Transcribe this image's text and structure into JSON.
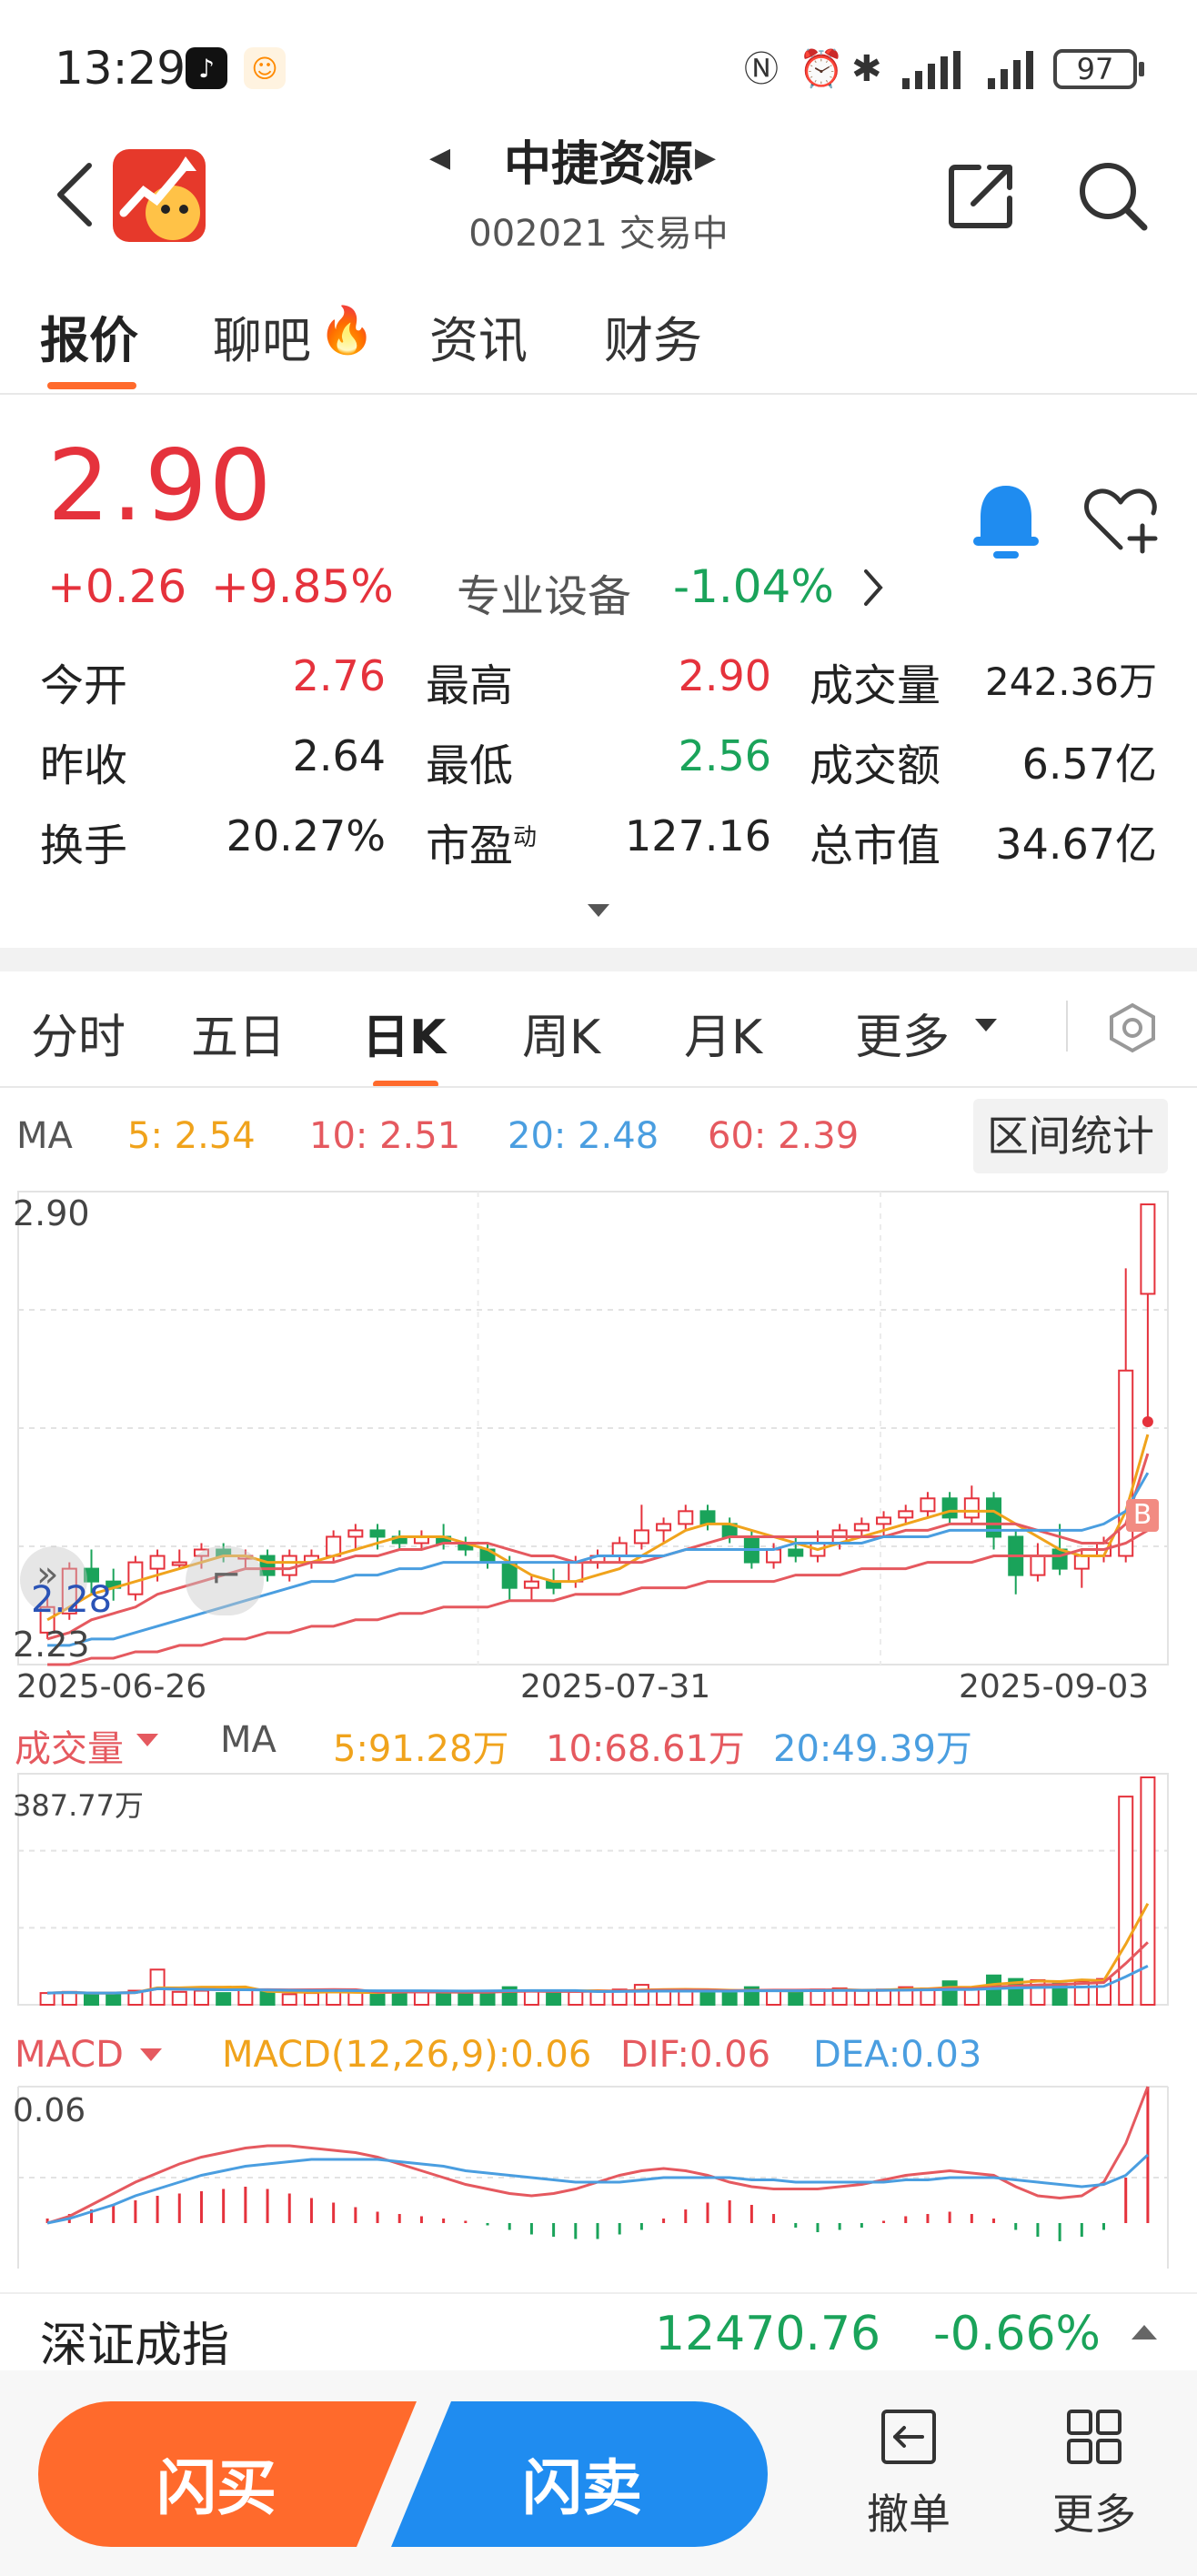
{
  "status_bar": {
    "time": "13:29",
    "battery": "97",
    "icons": [
      "tiktok-icon",
      "app-notify-icon",
      "nfc-icon",
      "alarm-icon",
      "bluetooth-icon",
      "signal-1-icon",
      "signal-2-icon",
      "battery-icon"
    ]
  },
  "header": {
    "title": "中捷资源",
    "subtitle": "002021 交易中",
    "icons": [
      "back-icon",
      "app-logo",
      "prev-stock-icon",
      "next-stock-icon",
      "share-icon",
      "search-icon"
    ]
  },
  "tabs": [
    "报价",
    "聊吧",
    "资讯",
    "财务"
  ],
  "active_tab": "报价",
  "quote": {
    "price": "2.90",
    "change": "+0.26",
    "change_pct": "+9.85%",
    "sector": "专业设备",
    "sector_change": "-1.04%",
    "rows": [
      [
        {
          "label": "今开",
          "value": "2.76",
          "tone": "red"
        },
        {
          "label": "最高",
          "value": "2.90",
          "tone": "red"
        },
        {
          "label": "成交量",
          "value": "242.36万",
          "tone": "dark"
        }
      ],
      [
        {
          "label": "昨收",
          "value": "2.64",
          "tone": "dark"
        },
        {
          "label": "最低",
          "value": "2.56",
          "tone": "green"
        },
        {
          "label": "成交额",
          "value": "6.57亿",
          "tone": "dark"
        }
      ],
      [
        {
          "label": "换手",
          "value": "20.27%",
          "tone": "dark"
        },
        {
          "label": "市盈",
          "label_sup": "动",
          "value": "127.16",
          "tone": "dark"
        },
        {
          "label": "总市值",
          "value": "34.67亿",
          "tone": "dark"
        }
      ]
    ],
    "colors": {
      "up": "#e5323c",
      "down": "#1aa35a",
      "accent": "#ff6a2c",
      "bell": "#1f8cf0"
    }
  },
  "chart_tabs": [
    "分时",
    "五日",
    "日K",
    "周K",
    "月K",
    "更多"
  ],
  "active_chart_tab": "日K",
  "ma_legend": {
    "label": "MA",
    "items": [
      {
        "text": "5:  2.54",
        "color": "#f0a31c"
      },
      {
        "text": "10:  2.51",
        "color": "#e5595f"
      },
      {
        "text": "20:  2.48",
        "color": "#4a9ee0"
      },
      {
        "text": "60:  2.39",
        "color": "#e5595f"
      }
    ],
    "range_button": "区间统计"
  },
  "kline_labels": {
    "max": "2.90",
    "current_marker": "2.28",
    "min": "2.23",
    "dates": [
      "2025-06-26",
      "2025-07-31",
      "2025-09-03"
    ],
    "buy_marker": "B"
  },
  "volume_legend": {
    "label": "成交量",
    "ma_label": "MA",
    "ma5": "5:91.28万",
    "ma10": "10:68.61万",
    "ma20": "20:49.39万",
    "max_label": "387.77万"
  },
  "macd_legend": {
    "label": "MACD",
    "params": "MACD(12,26,9):0.06",
    "dif": "DIF:0.06",
    "dea": "DEA:0.03",
    "max_label": "0.06"
  },
  "index_bar": {
    "name": "深证成指",
    "value": "12470.76",
    "change": "-0.66%"
  },
  "actions": {
    "buy": "闪买",
    "sell": "闪卖",
    "cancel": "撤单",
    "more": "更多"
  },
  "chart_data": [
    {
      "type": "candlestick",
      "title": "",
      "x_labels": [
        "2025-06-26",
        "2025-07-31",
        "2025-09-03"
      ],
      "ylim": [
        2.23,
        2.9
      ],
      "candles": [
        {
          "o": 2.23,
          "h": 2.29,
          "l": 2.22,
          "c": 2.27
        },
        {
          "o": 2.26,
          "h": 2.34,
          "l": 2.25,
          "c": 2.33
        },
        {
          "o": 2.33,
          "h": 2.36,
          "l": 2.29,
          "c": 2.31
        },
        {
          "o": 2.31,
          "h": 2.33,
          "l": 2.28,
          "c": 2.3
        },
        {
          "o": 2.29,
          "h": 2.35,
          "l": 2.28,
          "c": 2.34
        },
        {
          "o": 2.33,
          "h": 2.36,
          "l": 2.31,
          "c": 2.35
        },
        {
          "o": 2.34,
          "h": 2.36,
          "l": 2.33,
          "c": 2.34
        },
        {
          "o": 2.35,
          "h": 2.37,
          "l": 2.33,
          "c": 2.36
        },
        {
          "o": 2.36,
          "h": 2.37,
          "l": 2.34,
          "c": 2.35
        },
        {
          "o": 2.35,
          "h": 2.36,
          "l": 2.33,
          "c": 2.35
        },
        {
          "o": 2.35,
          "h": 2.36,
          "l": 2.31,
          "c": 2.32
        },
        {
          "o": 2.32,
          "h": 2.36,
          "l": 2.31,
          "c": 2.35
        },
        {
          "o": 2.34,
          "h": 2.36,
          "l": 2.33,
          "c": 2.35
        },
        {
          "o": 2.35,
          "h": 2.39,
          "l": 2.34,
          "c": 2.38
        },
        {
          "o": 2.38,
          "h": 2.4,
          "l": 2.36,
          "c": 2.39
        },
        {
          "o": 2.39,
          "h": 2.4,
          "l": 2.36,
          "c": 2.38
        },
        {
          "o": 2.38,
          "h": 2.39,
          "l": 2.36,
          "c": 2.37
        },
        {
          "o": 2.37,
          "h": 2.39,
          "l": 2.36,
          "c": 2.38
        },
        {
          "o": 2.38,
          "h": 2.4,
          "l": 2.36,
          "c": 2.37
        },
        {
          "o": 2.37,
          "h": 2.38,
          "l": 2.35,
          "c": 2.36
        },
        {
          "o": 2.36,
          "h": 2.37,
          "l": 2.33,
          "c": 2.34
        },
        {
          "o": 2.34,
          "h": 2.35,
          "l": 2.28,
          "c": 2.3
        },
        {
          "o": 2.3,
          "h": 2.32,
          "l": 2.28,
          "c": 2.31
        },
        {
          "o": 2.31,
          "h": 2.33,
          "l": 2.29,
          "c": 2.3
        },
        {
          "o": 2.31,
          "h": 2.35,
          "l": 2.3,
          "c": 2.34
        },
        {
          "o": 2.34,
          "h": 2.36,
          "l": 2.33,
          "c": 2.35
        },
        {
          "o": 2.35,
          "h": 2.38,
          "l": 2.34,
          "c": 2.37
        },
        {
          "o": 2.37,
          "h": 2.43,
          "l": 2.36,
          "c": 2.39
        },
        {
          "o": 2.39,
          "h": 2.41,
          "l": 2.37,
          "c": 2.4
        },
        {
          "o": 2.4,
          "h": 2.43,
          "l": 2.39,
          "c": 2.42
        },
        {
          "o": 2.42,
          "h": 2.43,
          "l": 2.39,
          "c": 2.4
        },
        {
          "o": 2.4,
          "h": 2.41,
          "l": 2.37,
          "c": 2.38
        },
        {
          "o": 2.38,
          "h": 2.39,
          "l": 2.33,
          "c": 2.34
        },
        {
          "o": 2.34,
          "h": 2.37,
          "l": 2.33,
          "c": 2.36
        },
        {
          "o": 2.36,
          "h": 2.38,
          "l": 2.34,
          "c": 2.35
        },
        {
          "o": 2.35,
          "h": 2.39,
          "l": 2.34,
          "c": 2.37
        },
        {
          "o": 2.37,
          "h": 2.4,
          "l": 2.36,
          "c": 2.39
        },
        {
          "o": 2.39,
          "h": 2.41,
          "l": 2.38,
          "c": 2.4
        },
        {
          "o": 2.4,
          "h": 2.42,
          "l": 2.38,
          "c": 2.41
        },
        {
          "o": 2.41,
          "h": 2.43,
          "l": 2.4,
          "c": 2.42
        },
        {
          "o": 2.42,
          "h": 2.45,
          "l": 2.41,
          "c": 2.44
        },
        {
          "o": 2.44,
          "h": 2.45,
          "l": 2.4,
          "c": 2.41
        },
        {
          "o": 2.41,
          "h": 2.46,
          "l": 2.4,
          "c": 2.44
        },
        {
          "o": 2.44,
          "h": 2.45,
          "l": 2.36,
          "c": 2.38
        },
        {
          "o": 2.38,
          "h": 2.39,
          "l": 2.29,
          "c": 2.32
        },
        {
          "o": 2.32,
          "h": 2.37,
          "l": 2.31,
          "c": 2.35
        },
        {
          "o": 2.36,
          "h": 2.4,
          "l": 2.32,
          "c": 2.33
        },
        {
          "o": 2.33,
          "h": 2.36,
          "l": 2.3,
          "c": 2.35
        },
        {
          "o": 2.35,
          "h": 2.38,
          "l": 2.34,
          "c": 2.37
        },
        {
          "o": 2.35,
          "h": 2.8,
          "l": 2.34,
          "c": 2.64
        },
        {
          "o": 2.76,
          "h": 2.9,
          "l": 2.56,
          "c": 2.9
        }
      ],
      "series": [
        {
          "name": "MA5",
          "values": [
            2.25,
            2.27,
            2.29,
            2.3,
            2.31,
            2.32,
            2.33,
            2.34,
            2.35,
            2.35,
            2.34,
            2.34,
            2.34,
            2.35,
            2.36,
            2.37,
            2.38,
            2.38,
            2.38,
            2.37,
            2.36,
            2.34,
            2.32,
            2.31,
            2.31,
            2.32,
            2.33,
            2.35,
            2.37,
            2.39,
            2.4,
            2.4,
            2.39,
            2.38,
            2.37,
            2.36,
            2.37,
            2.38,
            2.39,
            2.4,
            2.41,
            2.42,
            2.42,
            2.42,
            2.4,
            2.38,
            2.36,
            2.35,
            2.35,
            2.42,
            2.54
          ]
        },
        {
          "name": "MA10",
          "values": [
            2.22,
            2.23,
            2.25,
            2.26,
            2.27,
            2.29,
            2.3,
            2.31,
            2.32,
            2.33,
            2.33,
            2.33,
            2.34,
            2.34,
            2.35,
            2.35,
            2.36,
            2.36,
            2.37,
            2.37,
            2.37,
            2.36,
            2.35,
            2.35,
            2.34,
            2.34,
            2.34,
            2.34,
            2.35,
            2.36,
            2.37,
            2.38,
            2.38,
            2.38,
            2.38,
            2.38,
            2.38,
            2.38,
            2.38,
            2.39,
            2.39,
            2.4,
            2.4,
            2.4,
            2.4,
            2.39,
            2.38,
            2.37,
            2.37,
            2.4,
            2.51
          ]
        },
        {
          "name": "MA20",
          "values": [
            2.21,
            2.21,
            2.22,
            2.22,
            2.23,
            2.24,
            2.25,
            2.26,
            2.27,
            2.28,
            2.29,
            2.3,
            2.31,
            2.31,
            2.32,
            2.32,
            2.33,
            2.33,
            2.34,
            2.34,
            2.34,
            2.34,
            2.34,
            2.34,
            2.34,
            2.35,
            2.35,
            2.35,
            2.35,
            2.36,
            2.36,
            2.36,
            2.36,
            2.36,
            2.37,
            2.37,
            2.37,
            2.37,
            2.38,
            2.38,
            2.38,
            2.39,
            2.39,
            2.39,
            2.39,
            2.39,
            2.39,
            2.39,
            2.4,
            2.42,
            2.48
          ]
        },
        {
          "name": "MA60",
          "values": [
            2.18,
            2.18,
            2.19,
            2.19,
            2.2,
            2.2,
            2.21,
            2.21,
            2.22,
            2.22,
            2.23,
            2.23,
            2.24,
            2.24,
            2.25,
            2.25,
            2.26,
            2.26,
            2.27,
            2.27,
            2.27,
            2.28,
            2.28,
            2.28,
            2.29,
            2.29,
            2.29,
            2.3,
            2.3,
            2.3,
            2.31,
            2.31,
            2.31,
            2.31,
            2.32,
            2.32,
            2.32,
            2.33,
            2.33,
            2.33,
            2.34,
            2.34,
            2.34,
            2.35,
            2.35,
            2.35,
            2.35,
            2.36,
            2.36,
            2.37,
            2.39
          ]
        }
      ]
    },
    {
      "type": "bar",
      "title": "成交量",
      "ylim": [
        0,
        387.77
      ],
      "values": [
        20,
        22,
        18,
        20,
        24,
        60,
        22,
        24,
        20,
        26,
        22,
        18,
        20,
        24,
        22,
        20,
        22,
        24,
        20,
        22,
        22,
        30,
        24,
        20,
        22,
        24,
        26,
        34,
        24,
        24,
        22,
        20,
        30,
        24,
        22,
        26,
        28,
        24,
        26,
        30,
        28,
        40,
        26,
        50,
        44,
        42,
        36,
        40,
        44,
        355,
        387.77
      ]
    },
    {
      "type": "bar",
      "title": "MACD",
      "ylim": [
        -0.02,
        0.06
      ],
      "values": [
        0.002,
        0.004,
        0.006,
        0.008,
        0.01,
        0.012,
        0.013,
        0.014,
        0.015,
        0.016,
        0.015,
        0.013,
        0.011,
        0.009,
        0.007,
        0.005,
        0.004,
        0.003,
        0.002,
        0.001,
        -0.001,
        -0.003,
        -0.005,
        -0.006,
        -0.007,
        -0.007,
        -0.005,
        -0.003,
        0.002,
        0.006,
        0.009,
        0.01,
        0.008,
        0.004,
        -0.002,
        -0.004,
        -0.003,
        -0.002,
        0.001,
        0.003,
        0.004,
        0.005,
        0.004,
        0.002,
        -0.003,
        -0.006,
        -0.008,
        -0.006,
        -0.003,
        0.02,
        0.06
      ],
      "series": [
        {
          "name": "DIF",
          "values": [
            0.0,
            0.003,
            0.008,
            0.013,
            0.018,
            0.022,
            0.026,
            0.029,
            0.031,
            0.033,
            0.034,
            0.034,
            0.033,
            0.032,
            0.031,
            0.029,
            0.026,
            0.023,
            0.02,
            0.017,
            0.015,
            0.013,
            0.012,
            0.013,
            0.015,
            0.018,
            0.021,
            0.023,
            0.024,
            0.023,
            0.021,
            0.018,
            0.016,
            0.015,
            0.015,
            0.015,
            0.016,
            0.017,
            0.019,
            0.021,
            0.022,
            0.023,
            0.022,
            0.021,
            0.016,
            0.012,
            0.011,
            0.012,
            0.018,
            0.035,
            0.06
          ]
        },
        {
          "name": "DEA",
          "values": [
            0.0,
            0.002,
            0.005,
            0.008,
            0.012,
            0.015,
            0.018,
            0.021,
            0.023,
            0.025,
            0.026,
            0.027,
            0.028,
            0.028,
            0.028,
            0.028,
            0.027,
            0.026,
            0.025,
            0.023,
            0.022,
            0.021,
            0.02,
            0.019,
            0.018,
            0.018,
            0.018,
            0.019,
            0.02,
            0.02,
            0.02,
            0.02,
            0.019,
            0.019,
            0.018,
            0.018,
            0.018,
            0.018,
            0.018,
            0.019,
            0.019,
            0.02,
            0.02,
            0.02,
            0.019,
            0.018,
            0.017,
            0.016,
            0.017,
            0.021,
            0.03
          ]
        }
      ]
    }
  ]
}
